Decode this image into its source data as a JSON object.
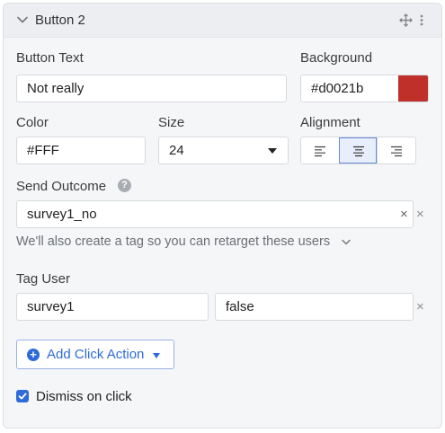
{
  "header": {
    "title": "Button 2"
  },
  "button_text": {
    "label": "Button Text",
    "value": "Not really"
  },
  "background": {
    "label": "Background",
    "value": "#d0021b",
    "swatch": "#c0302a"
  },
  "color": {
    "label": "Color",
    "value": "#FFF",
    "swatch": "#ffffff"
  },
  "size": {
    "label": "Size",
    "value": "24"
  },
  "alignment": {
    "label": "Alignment",
    "options": [
      "left",
      "center",
      "right"
    ],
    "selected": "center"
  },
  "send_outcome": {
    "label": "Send Outcome",
    "help": "?",
    "value": "survey1_no",
    "clear": "×",
    "remove": "×",
    "hint": "We'll also create a tag so you can retarget these users"
  },
  "tag_user": {
    "label": "Tag User",
    "key": "survey1",
    "value": "false",
    "remove": "×"
  },
  "add_click_action": {
    "plus": "+",
    "label": "Add Click Action"
  },
  "dismiss": {
    "label": "Dismiss on click",
    "checked": true
  },
  "accent_color": "#2f6bd8"
}
